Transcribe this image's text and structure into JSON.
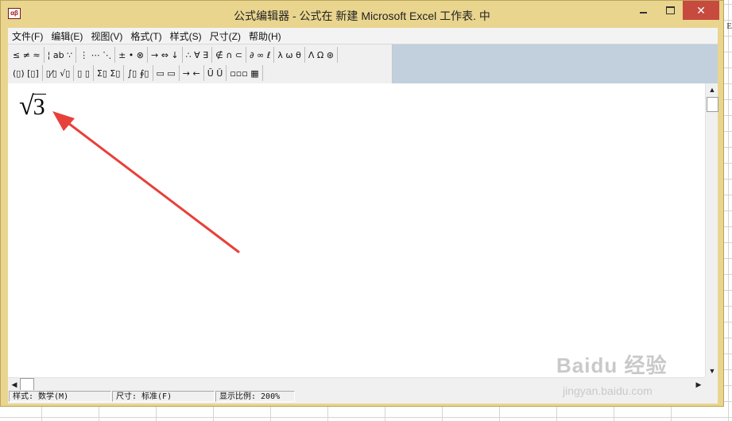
{
  "window": {
    "title": "公式编辑器 - 公式在 新建 Microsoft Excel 工作表. 中",
    "app_icon": "equation-editor-icon"
  },
  "menubar": {
    "items": [
      "文件(F)",
      "编辑(E)",
      "视图(V)",
      "格式(T)",
      "样式(S)",
      "尺寸(Z)",
      "帮助(H)"
    ]
  },
  "toolbar": {
    "row1": [
      "≤ ≠ ≈",
      "¦ ab ∵",
      "⋮ ⋯ ⋱",
      "± • ⊗",
      "→ ⇔ ↓",
      "∴ ∀ ∃",
      "∉ ∩ ⊂",
      "∂ ∞ ℓ",
      "λ ω θ",
      "Λ Ω ⊛"
    ],
    "row2": [
      "(▯) [▯]",
      "▯⁄▯ √▯",
      "▯ ▯",
      "Σ▯ Σ▯",
      "∫▯ ∮▯",
      "▭ ▭",
      "→ ←",
      "Ū Ǔ",
      "▫▫▫ ▦"
    ]
  },
  "editor": {
    "formula_symbol": "√",
    "formula_radicand": "3"
  },
  "statusbar": {
    "style": "样式: 数学(M)",
    "size": "尺寸: 标准(F)",
    "zoom": "显示比例: 200%"
  },
  "watermark": {
    "brand": "Baidu 经验",
    "url": "jingyan.baidu.com"
  },
  "sheet": {
    "edge_text": "E"
  },
  "colors": {
    "window_frame": "#e9d58e",
    "close_button": "#c74a3f",
    "toolbar_background": "#c2cfdd",
    "arrow": "#e8403a"
  }
}
